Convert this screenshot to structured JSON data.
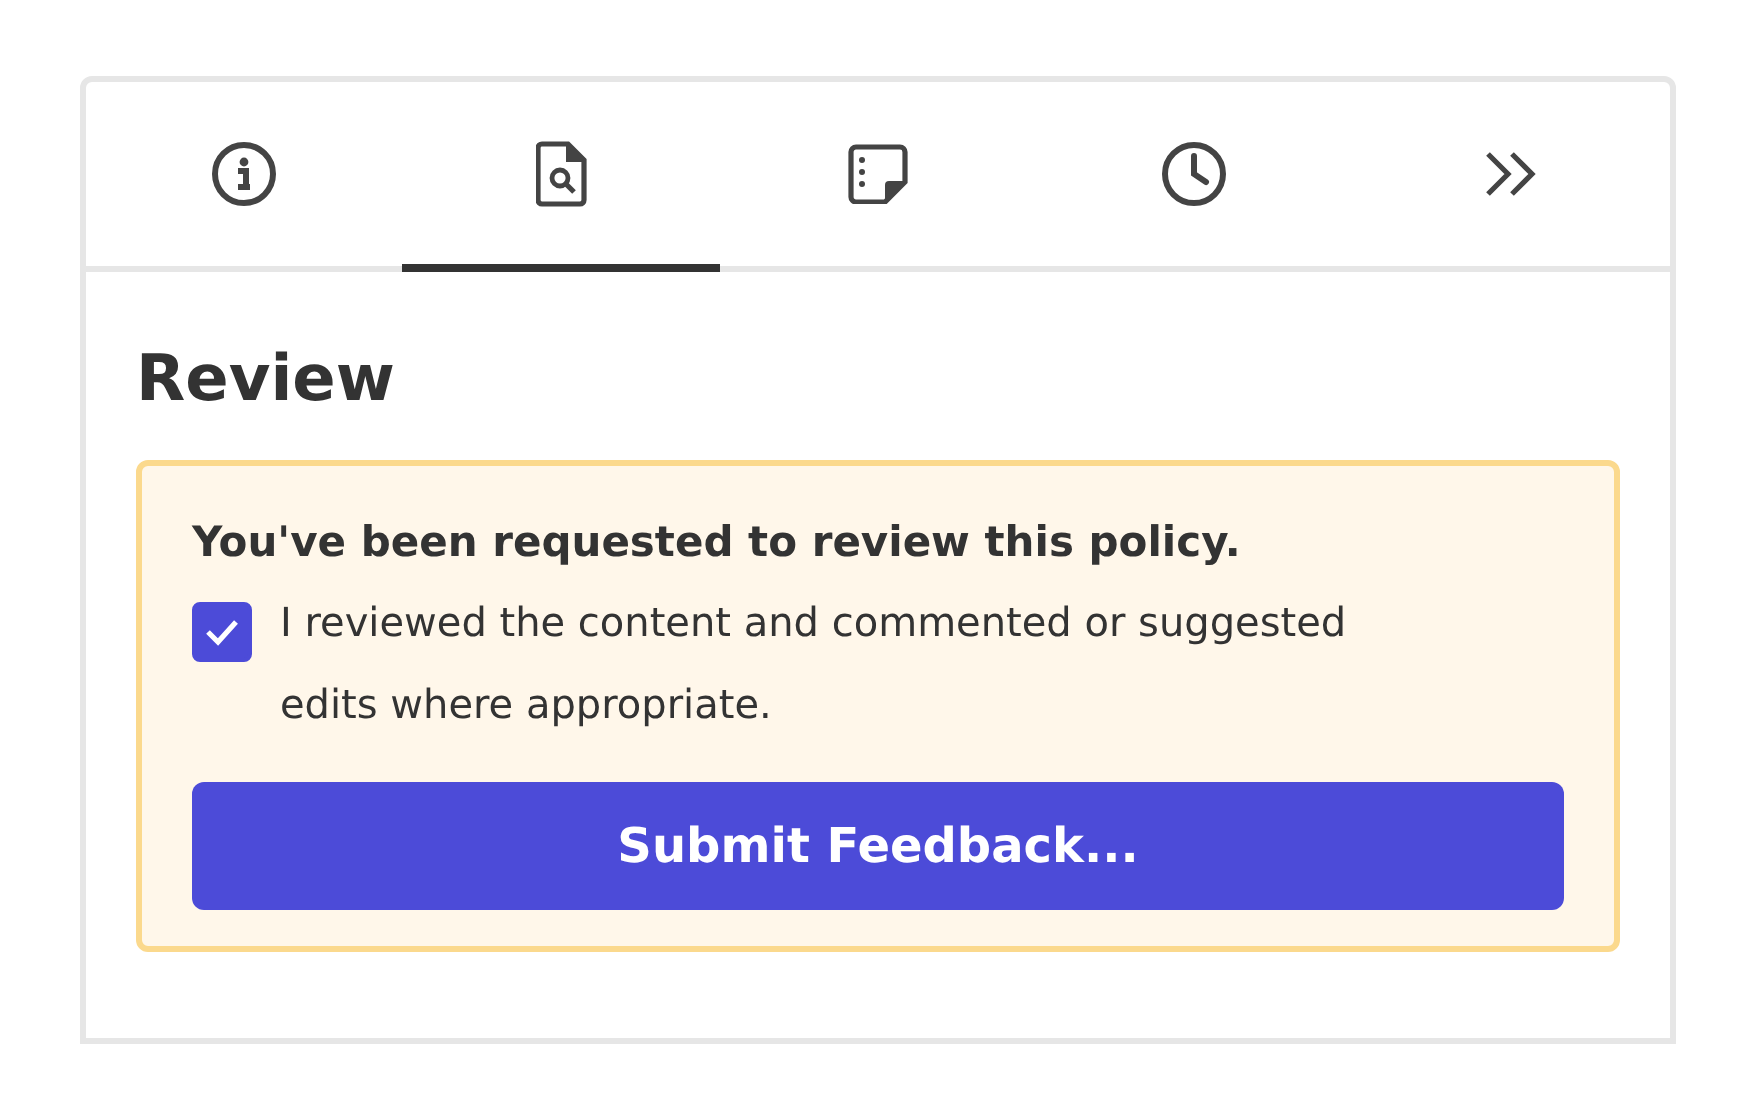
{
  "tabs": [
    {
      "kind": "info",
      "selected": false
    },
    {
      "kind": "review",
      "selected": true
    },
    {
      "kind": "notes",
      "selected": false
    },
    {
      "kind": "history",
      "selected": false
    },
    {
      "kind": "more",
      "selected": false
    }
  ],
  "section": {
    "title": "Review"
  },
  "review_request": {
    "heading": "You've been requested to review this policy.",
    "checkbox": {
      "label": "I reviewed the content and commented or suggested edits where appropriate.",
      "checked": true
    },
    "button": "Submit Feedback..."
  }
}
